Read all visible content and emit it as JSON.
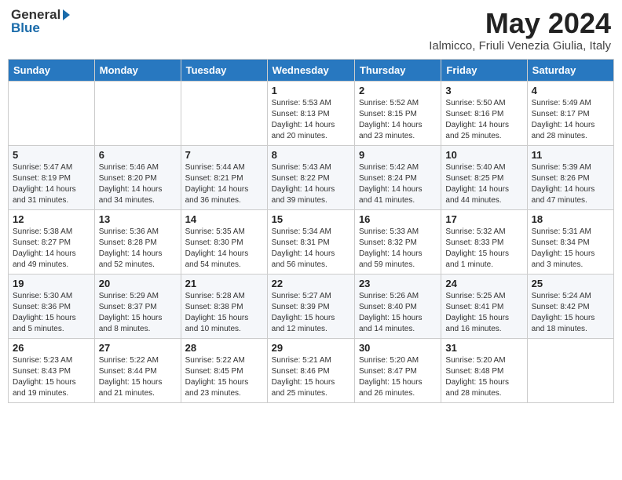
{
  "header": {
    "logo_general": "General",
    "logo_blue": "Blue",
    "month_title": "May 2024",
    "subtitle": "Ialmicco, Friuli Venezia Giulia, Italy"
  },
  "days_of_week": [
    "Sunday",
    "Monday",
    "Tuesday",
    "Wednesday",
    "Thursday",
    "Friday",
    "Saturday"
  ],
  "weeks": [
    [
      {
        "day": "",
        "info": ""
      },
      {
        "day": "",
        "info": ""
      },
      {
        "day": "",
        "info": ""
      },
      {
        "day": "1",
        "info": "Sunrise: 5:53 AM\nSunset: 8:13 PM\nDaylight: 14 hours\nand 20 minutes."
      },
      {
        "day": "2",
        "info": "Sunrise: 5:52 AM\nSunset: 8:15 PM\nDaylight: 14 hours\nand 23 minutes."
      },
      {
        "day": "3",
        "info": "Sunrise: 5:50 AM\nSunset: 8:16 PM\nDaylight: 14 hours\nand 25 minutes."
      },
      {
        "day": "4",
        "info": "Sunrise: 5:49 AM\nSunset: 8:17 PM\nDaylight: 14 hours\nand 28 minutes."
      }
    ],
    [
      {
        "day": "5",
        "info": "Sunrise: 5:47 AM\nSunset: 8:19 PM\nDaylight: 14 hours\nand 31 minutes."
      },
      {
        "day": "6",
        "info": "Sunrise: 5:46 AM\nSunset: 8:20 PM\nDaylight: 14 hours\nand 34 minutes."
      },
      {
        "day": "7",
        "info": "Sunrise: 5:44 AM\nSunset: 8:21 PM\nDaylight: 14 hours\nand 36 minutes."
      },
      {
        "day": "8",
        "info": "Sunrise: 5:43 AM\nSunset: 8:22 PM\nDaylight: 14 hours\nand 39 minutes."
      },
      {
        "day": "9",
        "info": "Sunrise: 5:42 AM\nSunset: 8:24 PM\nDaylight: 14 hours\nand 41 minutes."
      },
      {
        "day": "10",
        "info": "Sunrise: 5:40 AM\nSunset: 8:25 PM\nDaylight: 14 hours\nand 44 minutes."
      },
      {
        "day": "11",
        "info": "Sunrise: 5:39 AM\nSunset: 8:26 PM\nDaylight: 14 hours\nand 47 minutes."
      }
    ],
    [
      {
        "day": "12",
        "info": "Sunrise: 5:38 AM\nSunset: 8:27 PM\nDaylight: 14 hours\nand 49 minutes."
      },
      {
        "day": "13",
        "info": "Sunrise: 5:36 AM\nSunset: 8:28 PM\nDaylight: 14 hours\nand 52 minutes."
      },
      {
        "day": "14",
        "info": "Sunrise: 5:35 AM\nSunset: 8:30 PM\nDaylight: 14 hours\nand 54 minutes."
      },
      {
        "day": "15",
        "info": "Sunrise: 5:34 AM\nSunset: 8:31 PM\nDaylight: 14 hours\nand 56 minutes."
      },
      {
        "day": "16",
        "info": "Sunrise: 5:33 AM\nSunset: 8:32 PM\nDaylight: 14 hours\nand 59 minutes."
      },
      {
        "day": "17",
        "info": "Sunrise: 5:32 AM\nSunset: 8:33 PM\nDaylight: 15 hours\nand 1 minute."
      },
      {
        "day": "18",
        "info": "Sunrise: 5:31 AM\nSunset: 8:34 PM\nDaylight: 15 hours\nand 3 minutes."
      }
    ],
    [
      {
        "day": "19",
        "info": "Sunrise: 5:30 AM\nSunset: 8:36 PM\nDaylight: 15 hours\nand 5 minutes."
      },
      {
        "day": "20",
        "info": "Sunrise: 5:29 AM\nSunset: 8:37 PM\nDaylight: 15 hours\nand 8 minutes."
      },
      {
        "day": "21",
        "info": "Sunrise: 5:28 AM\nSunset: 8:38 PM\nDaylight: 15 hours\nand 10 minutes."
      },
      {
        "day": "22",
        "info": "Sunrise: 5:27 AM\nSunset: 8:39 PM\nDaylight: 15 hours\nand 12 minutes."
      },
      {
        "day": "23",
        "info": "Sunrise: 5:26 AM\nSunset: 8:40 PM\nDaylight: 15 hours\nand 14 minutes."
      },
      {
        "day": "24",
        "info": "Sunrise: 5:25 AM\nSunset: 8:41 PM\nDaylight: 15 hours\nand 16 minutes."
      },
      {
        "day": "25",
        "info": "Sunrise: 5:24 AM\nSunset: 8:42 PM\nDaylight: 15 hours\nand 18 minutes."
      }
    ],
    [
      {
        "day": "26",
        "info": "Sunrise: 5:23 AM\nSunset: 8:43 PM\nDaylight: 15 hours\nand 19 minutes."
      },
      {
        "day": "27",
        "info": "Sunrise: 5:22 AM\nSunset: 8:44 PM\nDaylight: 15 hours\nand 21 minutes."
      },
      {
        "day": "28",
        "info": "Sunrise: 5:22 AM\nSunset: 8:45 PM\nDaylight: 15 hours\nand 23 minutes."
      },
      {
        "day": "29",
        "info": "Sunrise: 5:21 AM\nSunset: 8:46 PM\nDaylight: 15 hours\nand 25 minutes."
      },
      {
        "day": "30",
        "info": "Sunrise: 5:20 AM\nSunset: 8:47 PM\nDaylight: 15 hours\nand 26 minutes."
      },
      {
        "day": "31",
        "info": "Sunrise: 5:20 AM\nSunset: 8:48 PM\nDaylight: 15 hours\nand 28 minutes."
      },
      {
        "day": "",
        "info": ""
      }
    ]
  ]
}
